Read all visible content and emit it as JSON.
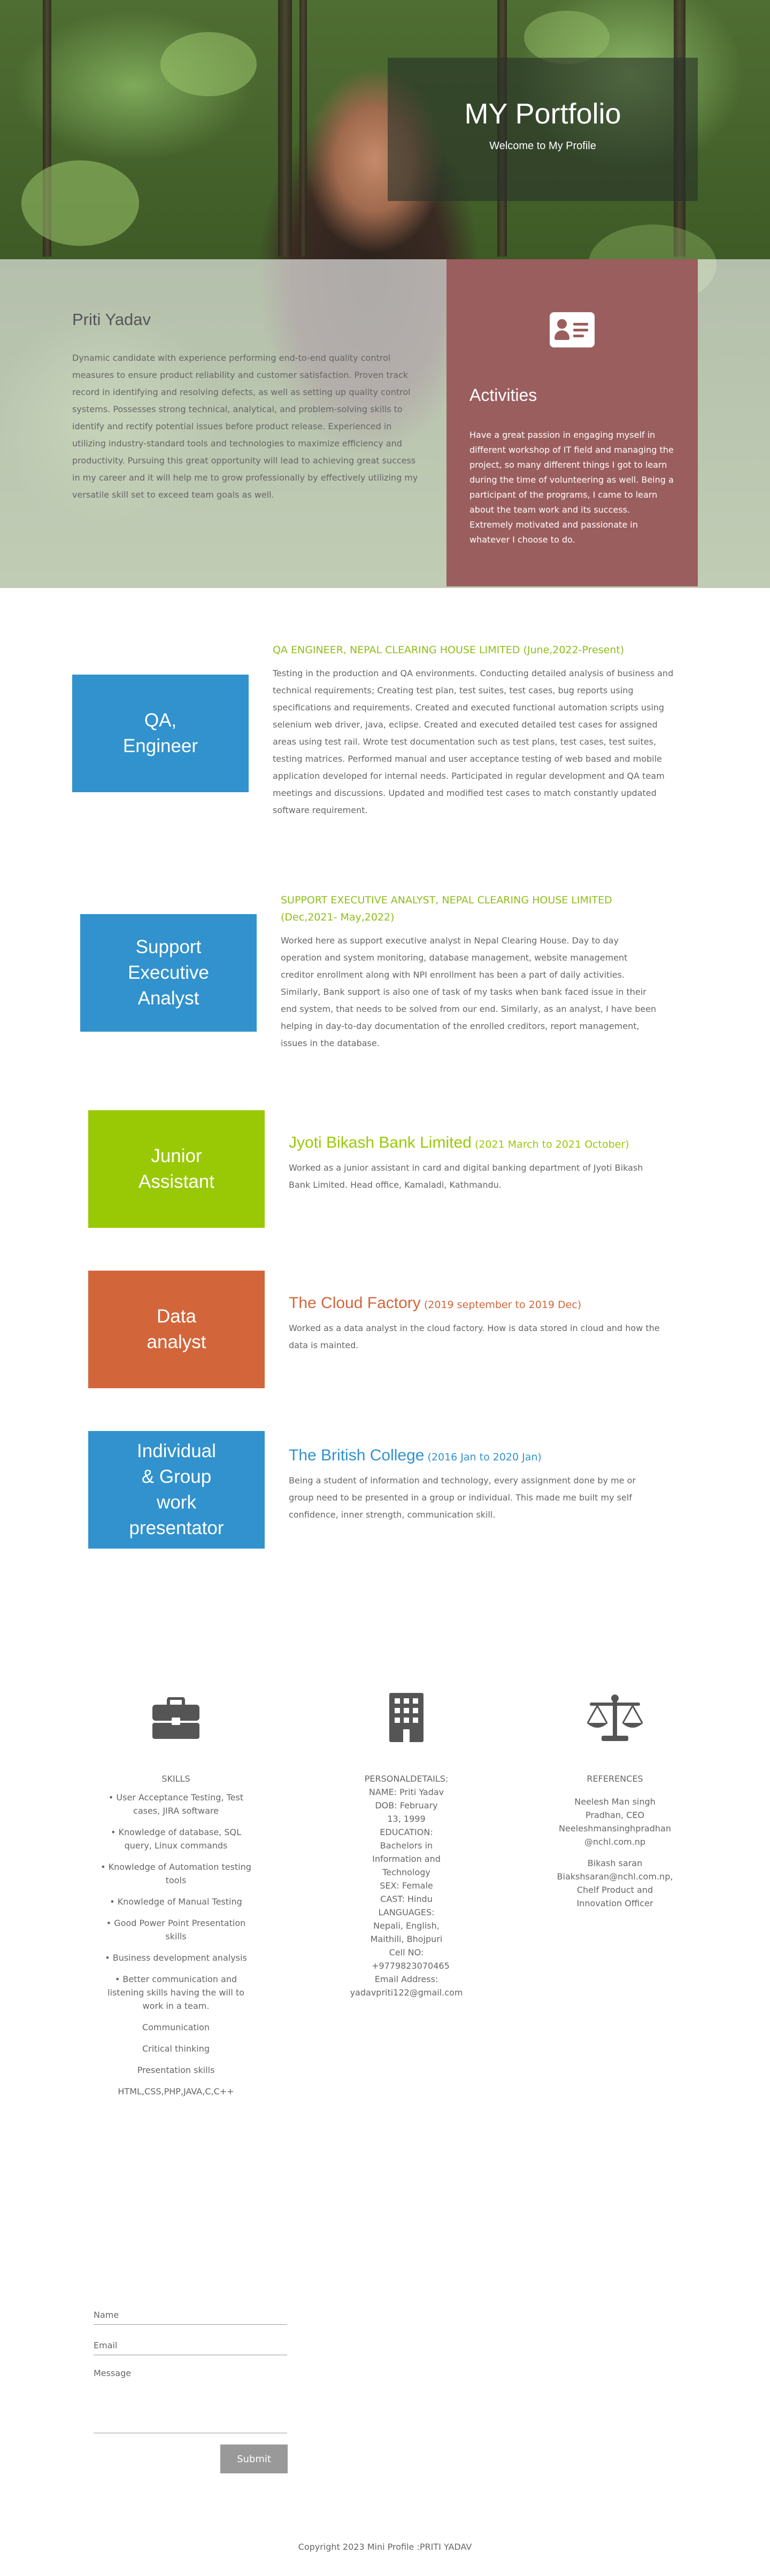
{
  "hero": {
    "title": "MY Portfolio",
    "subtitle": "Welcome to My Profile"
  },
  "about": {
    "name": "Priti Yadav",
    "summary": "Dynamic candidate with experience performing end-to-end quality control measures to ensure product reliability and customer satisfaction. Proven track record in identifying and resolving defects, as well as setting up quality control systems. Possesses strong technical, analytical, and problem-solving skills to identify and rectify potential issues before product release. Experienced in utilizing industry-standard tools and technologies to maximize efficiency and productivity. Pursuing this great opportunity will lead to achieving great success in my career and it will help me to grow professionally by effectively utilizing my versatile skill set to exceed team goals as well."
  },
  "activities": {
    "icon": "id-card-icon",
    "title": "Activities",
    "text": "Have a great passion in engaging myself in different workshop of IT field and managing the project, so many different things I got to learn during the time of volunteering as well. Being a participant of the programs, I came to learn about the team work and its success. Extremely motivated and passionate in whatever I choose to do."
  },
  "experience": [
    {
      "box_label": "QA,\nEngineer",
      "box_color": "#3192cd",
      "heading": "QA ENGINEER, NEPAL CLEARING HOUSE LIMITED (June,2022-Present)",
      "heading_color": "#8fbe1a",
      "description": "Testing in the production and QA environments. Conducting detailed analysis of business and technical requirements; Creating test plan, test suites, test cases, bug reports using specifications and requirements. Created and executed functional automation scripts using selenium web driver, java, eclipse. Created and executed detailed test cases for assigned areas using test rail. Wrote test documentation such as test plans, test cases, test suites, testing matrices. Performed manual and user acceptance testing of web based and mobile application developed for internal needs. Participated in regular development and QA team meetings and discussions. Updated and modified test cases to match constantly updated software requirement."
    },
    {
      "box_label": "Support\nExecutive\nAnalyst",
      "box_color": "#3192cd",
      "heading": "SUPPORT EXECUTIVE ANALYST, NEPAL CLEARING HOUSE LIMITED (Dec,2021- May,2022)",
      "heading_color": "#8fbe1a",
      "description": "Worked here as support executive analyst in Nepal Clearing House. Day to day operation and system monitoring, database management, website management creditor enrollment along with NPI enrollment has been a part of daily activities. Similarly, Bank support is also one of task of my tasks when bank faced issue in their end system, that needs to be solved from our end. Similarly, as an analyst, I have been helping in day-to-day documentation of the enrolled creditors, report management, issues in the database."
    },
    {
      "box_label": "Junior\nAssistant",
      "box_color": "#99c905",
      "name": "Jyoti Bikash Bank Limited",
      "date": "(2021 March to 2021 October)",
      "heading_color": "#99c905",
      "description": "Worked as a junior assistant in card and digital banking department of Jyoti Bikash Bank Limited. Head office, Kamaladi, Kathmandu."
    },
    {
      "box_label": "Data\nanalyst",
      "box_color": "#d2663a",
      "name": "The Cloud Factory",
      "date": "(2019 september to 2019 Dec)",
      "heading_color": "#d2663a",
      "description": "Worked as a data analyst in the cloud factory. How is data stored in cloud and how the data is mainted."
    },
    {
      "box_label": "Individual\n& Group\nwork\npresentator",
      "box_color": "#3192cd",
      "name": "The British College",
      "date": "(2016 Jan to 2020 Jan)",
      "heading_color": "#3192cd",
      "description": "Being a student of information and technology, every assignment done by me or group need to be presented in a group or individual. This made me built my self confidence, inner strength, communication skill."
    }
  ],
  "skills": {
    "icon": "briefcase-icon",
    "heading": "SKILLS",
    "items": [
      "• User Acceptance Testing, Test cases, JIRA software",
      "• Knowledge of database, SQL query, Linux commands",
      "• Knowledge of Automation testing tools",
      "• Knowledge of Manual Testing",
      "• Good Power Point Presentation skills",
      "• Business development analysis",
      "• Better communication and listening skills having the will to work in a team.",
      "Communication",
      "Critical thinking",
      "Presentation skills",
      "HTML,CSS,PHP,JAVA,C,C++"
    ]
  },
  "personal": {
    "icon": "building-icon",
    "lines": [
      "PERSONALDETAILS:",
      "NAME: Priti Yadav",
      "DOB: February 13, 1999",
      "EDUCATION: Bachelors in Information and Technology",
      "SEX: Female",
      "CAST: Hindu",
      "LANGUAGES: Nepali, English, Maithili, Bhojpuri",
      "Cell NO: +9779823070465",
      "Email Address: yadavpriti122@gmail.com"
    ]
  },
  "references": {
    "icon": "balance-scale-icon",
    "heading": "REFERENCES",
    "ref1": [
      "Neelesh Man singh Pradhan, CEO",
      "Neeleshmansinghpradhan @nchl.com.np"
    ],
    "ref2": [
      "Bikash saran",
      "Biakshsaran@nchl.com.np,",
      "Chelf Product and Innovation Officer"
    ]
  },
  "form": {
    "name_placeholder": "Name",
    "email_placeholder": "Email",
    "message_placeholder": "Message",
    "submit_label": "Submit"
  },
  "footer": {
    "text": "Copyright 2023 Mini Profile :PRITI YADAV"
  }
}
